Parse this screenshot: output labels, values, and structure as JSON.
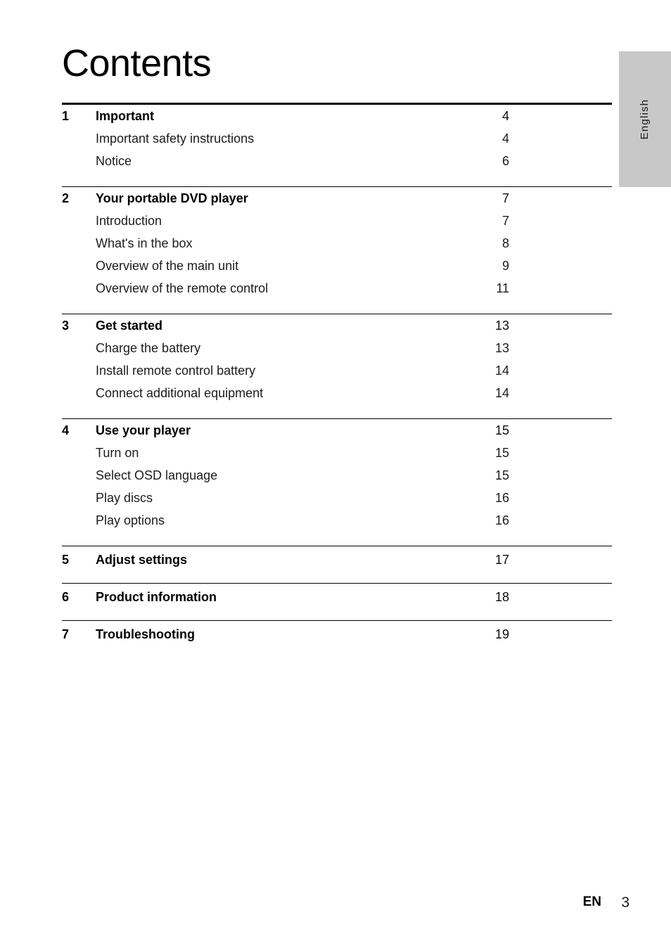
{
  "document": {
    "title": "Contents",
    "language_tab": "English"
  },
  "toc": {
    "sections": [
      {
        "number": "1",
        "title": "Important",
        "page": "4",
        "items": [
          {
            "label": "Important safety instructions",
            "page": "4"
          },
          {
            "label": "Notice",
            "page": "6"
          }
        ]
      },
      {
        "number": "2",
        "title": "Your portable DVD player",
        "page": "7",
        "items": [
          {
            "label": "Introduction",
            "page": "7"
          },
          {
            "label": "What's in the box",
            "page": "8"
          },
          {
            "label": "Overview of the main unit",
            "page": "9"
          },
          {
            "label": "Overview of the remote control",
            "page": "11"
          }
        ]
      },
      {
        "number": "3",
        "title": "Get started",
        "page": "13",
        "items": [
          {
            "label": "Charge the battery",
            "page": "13"
          },
          {
            "label": "Install remote control battery",
            "page": "14"
          },
          {
            "label": "Connect additional equipment",
            "page": "14"
          }
        ]
      },
      {
        "number": "4",
        "title": "Use your player",
        "page": "15",
        "items": [
          {
            "label": "Turn on",
            "page": "15"
          },
          {
            "label": "Select OSD language",
            "page": "15"
          },
          {
            "label": "Play discs",
            "page": "16"
          },
          {
            "label": "Play options",
            "page": "16"
          }
        ]
      },
      {
        "number": "5",
        "title": "Adjust settings",
        "page": "17",
        "items": []
      },
      {
        "number": "6",
        "title": "Product information",
        "page": "18",
        "items": []
      },
      {
        "number": "7",
        "title": "Troubleshooting",
        "page": "19",
        "items": []
      }
    ]
  },
  "footer": {
    "language_code": "EN",
    "page_number": "3"
  },
  "colors": {
    "tab_background": "#c8c8c8",
    "text": "#1c1c1c",
    "rule": "#000000"
  }
}
